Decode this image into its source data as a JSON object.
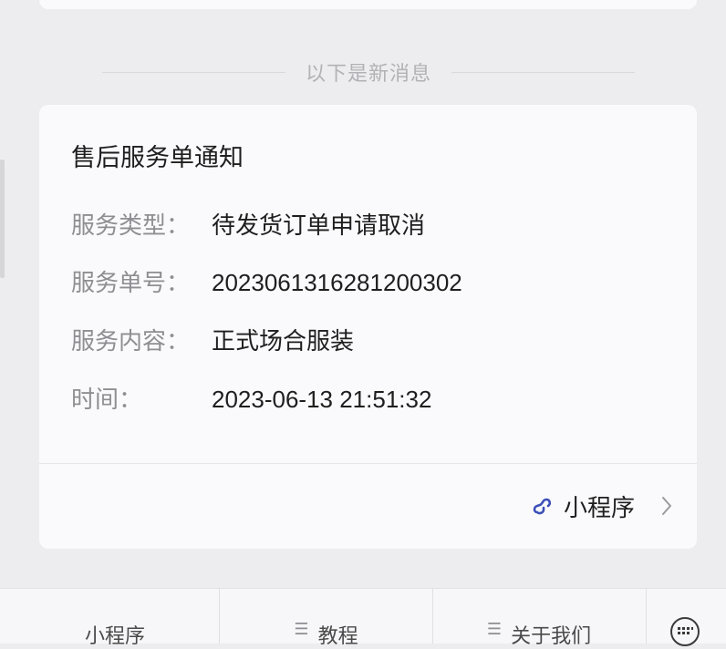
{
  "divider": {
    "text": "以下是新消息"
  },
  "notification": {
    "title": "售后服务单通知",
    "fields": [
      {
        "label": "服务类型：",
        "value": "待发货订单申请取消"
      },
      {
        "label": "服务单号：",
        "value": "2023061316281200302"
      },
      {
        "label": "服务内容：",
        "value": "正式场合服装"
      },
      {
        "label": "时间：",
        "value": "2023-06-13 21:51:32"
      }
    ],
    "link": {
      "label": "小程序",
      "icon": "mini-program-icon"
    }
  },
  "bottom_tabs": [
    {
      "label": "小程序",
      "has_menu": false
    },
    {
      "label": "教程",
      "has_menu": true
    },
    {
      "label": "关于我们",
      "has_menu": true
    }
  ],
  "colors": {
    "accent_link": "#3b4fb8",
    "card": "#fafafc",
    "background": "#ededf0"
  }
}
